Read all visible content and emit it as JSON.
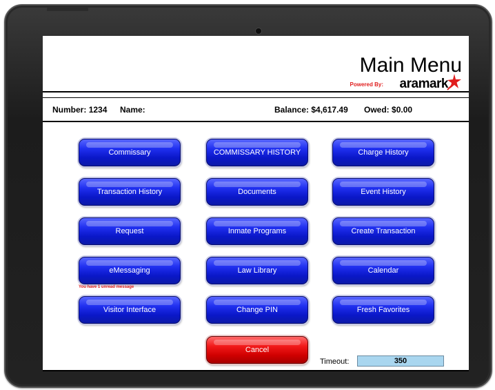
{
  "header": {
    "title": "Main Menu",
    "powered_by": "Powered By:",
    "brand": "aramark"
  },
  "info": {
    "number_label": "Number:",
    "number_value": "1234",
    "name_label": "Name:",
    "name_value": "",
    "balance_label": "Balance:",
    "balance_value": "$4,617.49",
    "owed_label": "Owed:",
    "owed_value": "$0.00"
  },
  "menu": {
    "commissary": "Commissary",
    "commissary_history": "COMMISSARY HISTORY",
    "charge_history": "Charge History",
    "transaction_history": "Transaction History",
    "documents": "Documents",
    "event_history": "Event History",
    "request": "Request",
    "inmate_programs": "Inmate Programs",
    "create_transaction": "Create Transaction",
    "emessaging": "eMessaging",
    "law_library": "Law Library",
    "calendar": "Calendar",
    "visitor_interface": "Visitor Interface",
    "change_pin": "Change PIN",
    "fresh_favorites": "Fresh Favorites",
    "cancel": "Cancel"
  },
  "notice": {
    "unread": "You have 1 unread message"
  },
  "timeout": {
    "label": "Timeout:",
    "value": "350"
  },
  "colors": {
    "button_blue": "#1422e0",
    "button_red": "#e01010",
    "accent_red": "#e01e1e",
    "timeout_bg": "#a9d6ef"
  }
}
